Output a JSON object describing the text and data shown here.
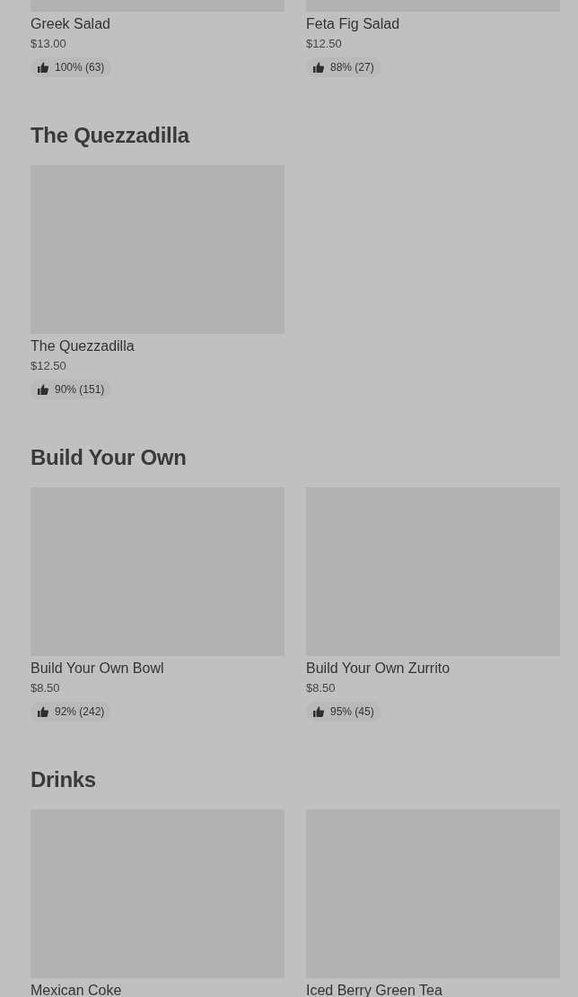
{
  "sections": [
    {
      "items": [
        {
          "name": "Greek Salad",
          "price": "$13.00",
          "rating": "100% (63)"
        },
        {
          "name": "Feta Fig Salad",
          "price": "$12.50",
          "rating": "88% (27)"
        }
      ]
    },
    {
      "heading": "The Quezzadilla",
      "items": [
        {
          "name": "The Quezzadilla",
          "price": "$12.50",
          "rating": "90% (151)"
        }
      ]
    },
    {
      "heading": "Build Your Own",
      "items": [
        {
          "name": "Build Your Own Bowl",
          "price": "$8.50",
          "rating": "92% (242)"
        },
        {
          "name": "Build Your Own Zurrito",
          "price": "$8.50",
          "rating": "95% (45)"
        }
      ]
    },
    {
      "heading": "Drinks",
      "items": [
        {
          "name": "Mexican Coke"
        },
        {
          "name": "Iced Berry Green Tea"
        }
      ]
    }
  ]
}
